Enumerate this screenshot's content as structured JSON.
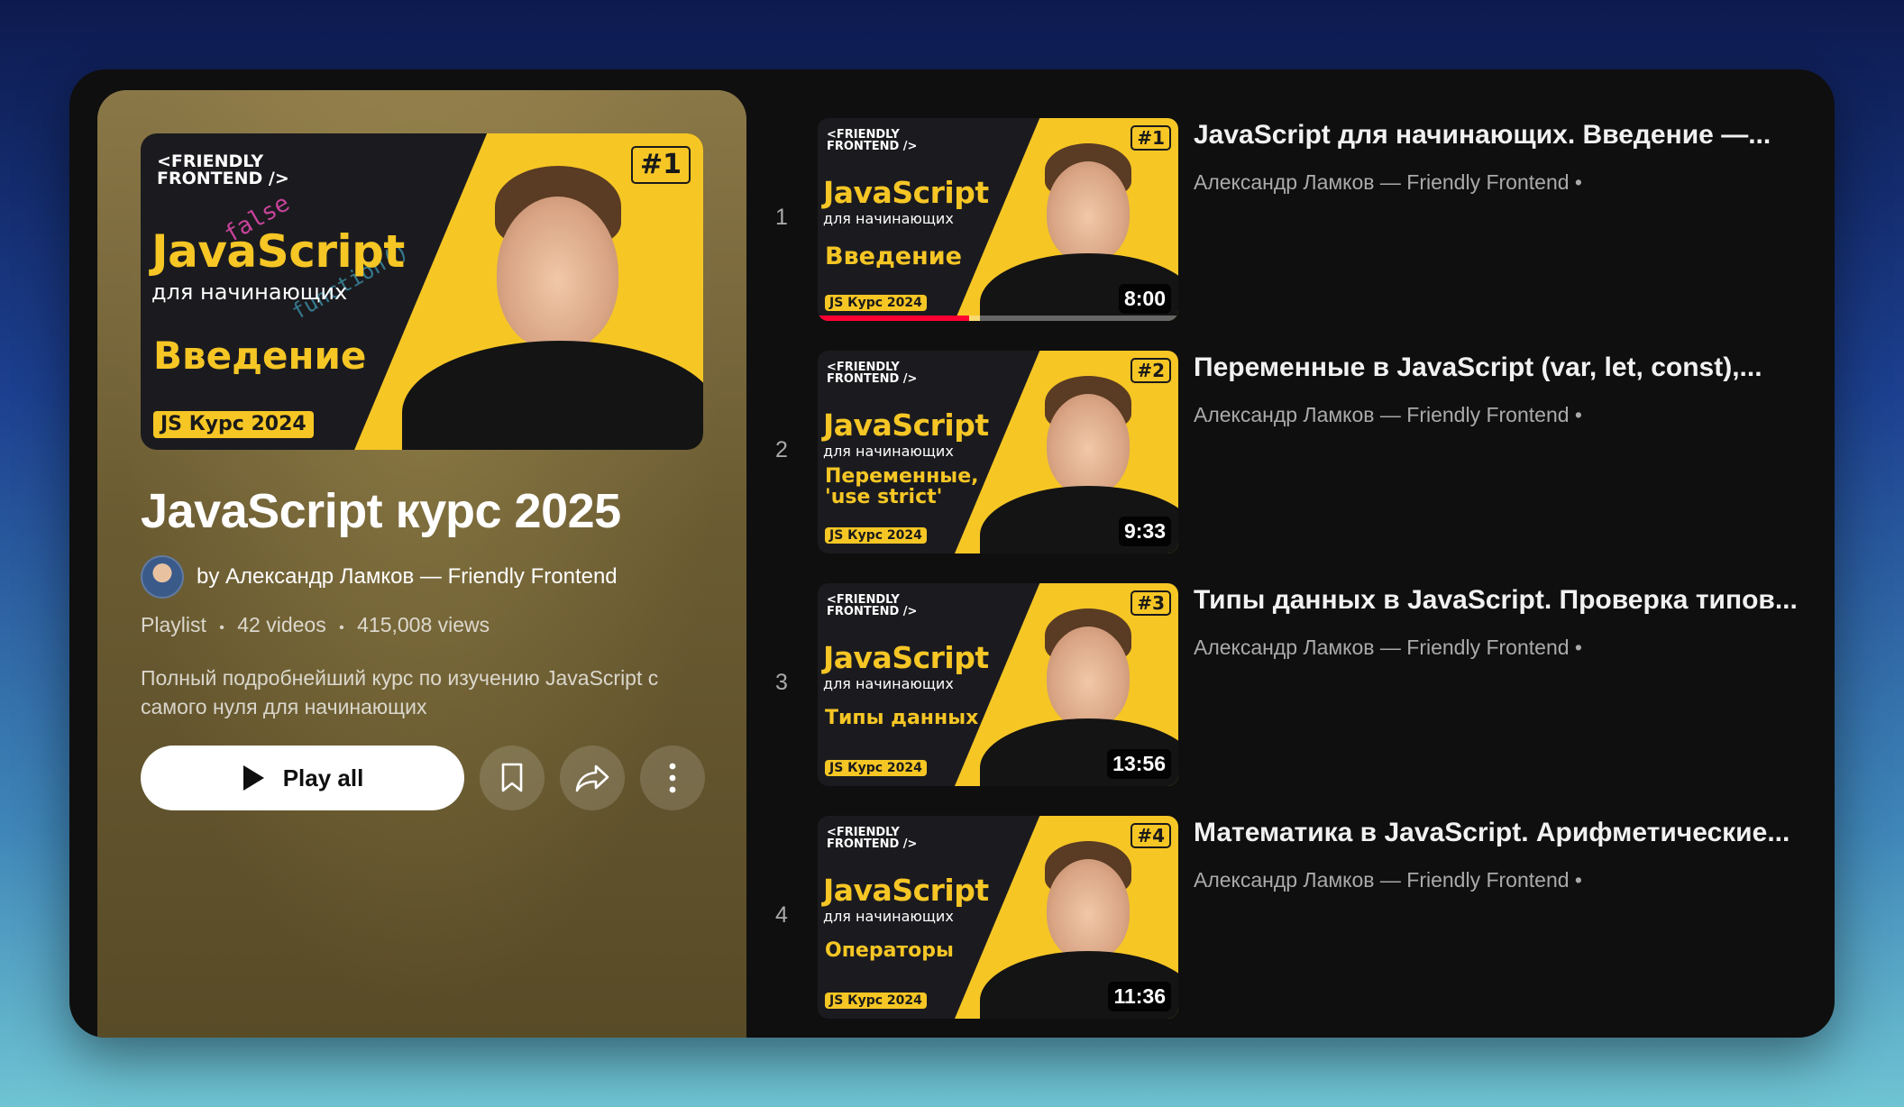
{
  "playlist": {
    "title": "JavaScript курс 2025",
    "author": "by Александр Ламков — Friendly Frontend",
    "meta": {
      "type": "Playlist",
      "videos": "42 videos",
      "views": "415,008 views",
      "separator": "•"
    },
    "description": "Полный подробнейший курс по изучению JavaScript с самого нуля для начинающих",
    "play_all_label": "Play all",
    "hero_thumb": {
      "brand": "<FRIENDLY\nFRONTEND />",
      "js": "JavaScript",
      "sub": "для начинающих",
      "topic": "Введение",
      "course": "JS Курс 2024",
      "num": "#1",
      "false_word": "false",
      "code_word": "function()"
    }
  },
  "videos": [
    {
      "index": "1",
      "title": "JavaScript для начинающих. Введение —...",
      "channel": "Александр Ламков — Friendly Frontend •",
      "duration": "8:00",
      "watched": 0.42,
      "thumb": {
        "num": "#1",
        "topic": "Введение",
        "js": "JavaScript",
        "sub": "для начинающих",
        "course": "JS Курс 2024",
        "brand": "<FRIENDLY\nFRONTEND />"
      }
    },
    {
      "index": "2",
      "title": "Переменные в JavaScript (var, let, const),...",
      "channel": "Александр Ламков — Friendly Frontend •",
      "duration": "9:33",
      "watched": 0,
      "thumb": {
        "num": "#2",
        "topic": "Переменные,\n'use strict'",
        "js": "JavaScript",
        "sub": "для начинающих",
        "course": "JS Курс 2024",
        "brand": "<FRIENDLY\nFRONTEND />"
      }
    },
    {
      "index": "3",
      "title": "Типы данных в JavaScript. Проверка типов...",
      "channel": "Александр Ламков — Friendly Frontend •",
      "duration": "13:56",
      "watched": 0,
      "thumb": {
        "num": "#3",
        "topic": "Типы данных",
        "js": "JavaScript",
        "sub": "для начинающих",
        "course": "JS Курс 2024",
        "brand": "<FRIENDLY\nFRONTEND />"
      }
    },
    {
      "index": "4",
      "title": "Математика в JavaScript. Арифметические...",
      "channel": "Александр Ламков — Friendly Frontend •",
      "duration": "11:36",
      "watched": 0,
      "thumb": {
        "num": "#4",
        "topic": "Операторы",
        "js": "JavaScript",
        "sub": "для начинающих",
        "course": "JS Курс 2024",
        "brand": "<FRIENDLY\nFRONTEND />"
      }
    }
  ],
  "icons": {
    "play": "play-icon",
    "save": "bookmark-icon",
    "share": "share-icon",
    "more": "more-vertical-icon"
  },
  "colors": {
    "accent_yellow": "#f6c625",
    "progress_red": "#ff0033",
    "panel_bg": "#0f0f0f"
  }
}
